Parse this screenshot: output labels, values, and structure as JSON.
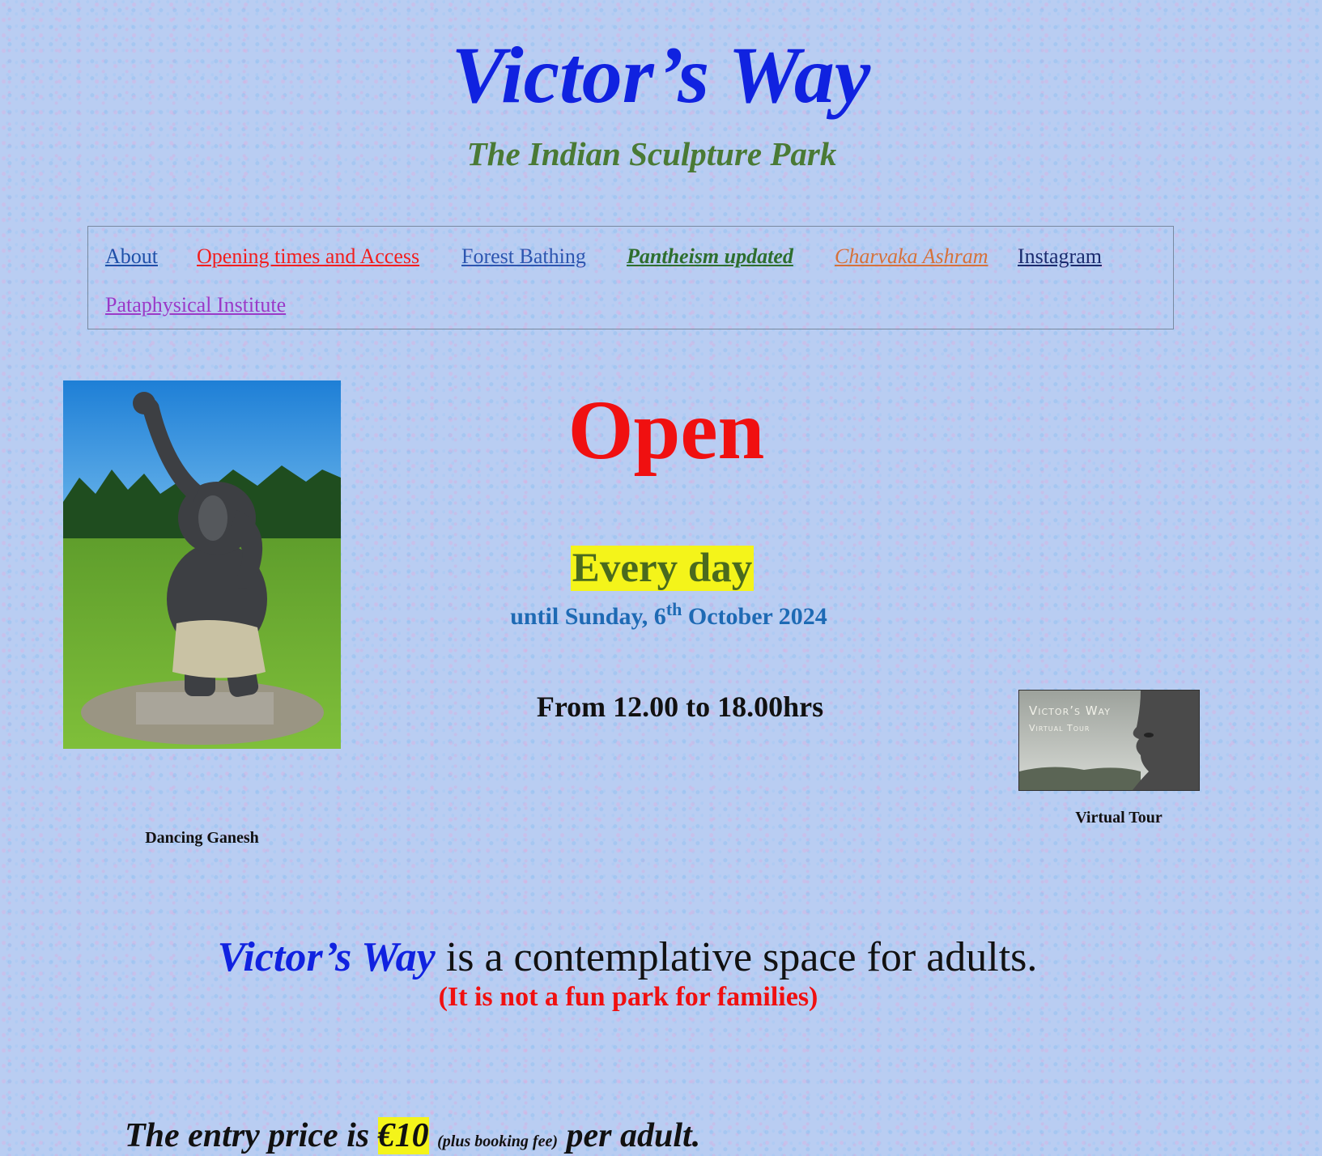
{
  "header": {
    "title": "Victor’s Way",
    "subtitle": "The Indian Sculpture Park"
  },
  "nav": {
    "about": "About",
    "opening": "Opening times and Access",
    "forest": "Forest Bathing",
    "pantheism": "Pantheism updated",
    "charvaka": "Charvaka Ashram",
    "instagram": "Instagram",
    "pataphysical": "Pataphysical Institute"
  },
  "featured": {
    "caption": "Dancing Ganesh"
  },
  "status": {
    "open": "Open",
    "everyday": "Every day",
    "until_prefix": "until Sunday, 6",
    "until_sup": "th",
    "until_suffix": " October 2024",
    "hours": "From 12.00 to 18.00hrs"
  },
  "virtual_tour": {
    "thumb_line1": "Victor’s Way",
    "thumb_line2": "Virtual Tour",
    "caption": "Virtual Tour"
  },
  "intro": {
    "brand": "Victor’s Way",
    "text": " is a contemplative space for adults.",
    "note": "(It is not a fun park for families)"
  },
  "price": {
    "prefix": "The entry price is ",
    "amount": "€10",
    "fee": "(plus booking fee)",
    "suffix": "per adult."
  },
  "colors": {
    "title": "#1022e0",
    "subtitle": "#4a7a35",
    "open": "#f01010",
    "highlight": "#f4f41a",
    "until": "#1e6ab4"
  }
}
